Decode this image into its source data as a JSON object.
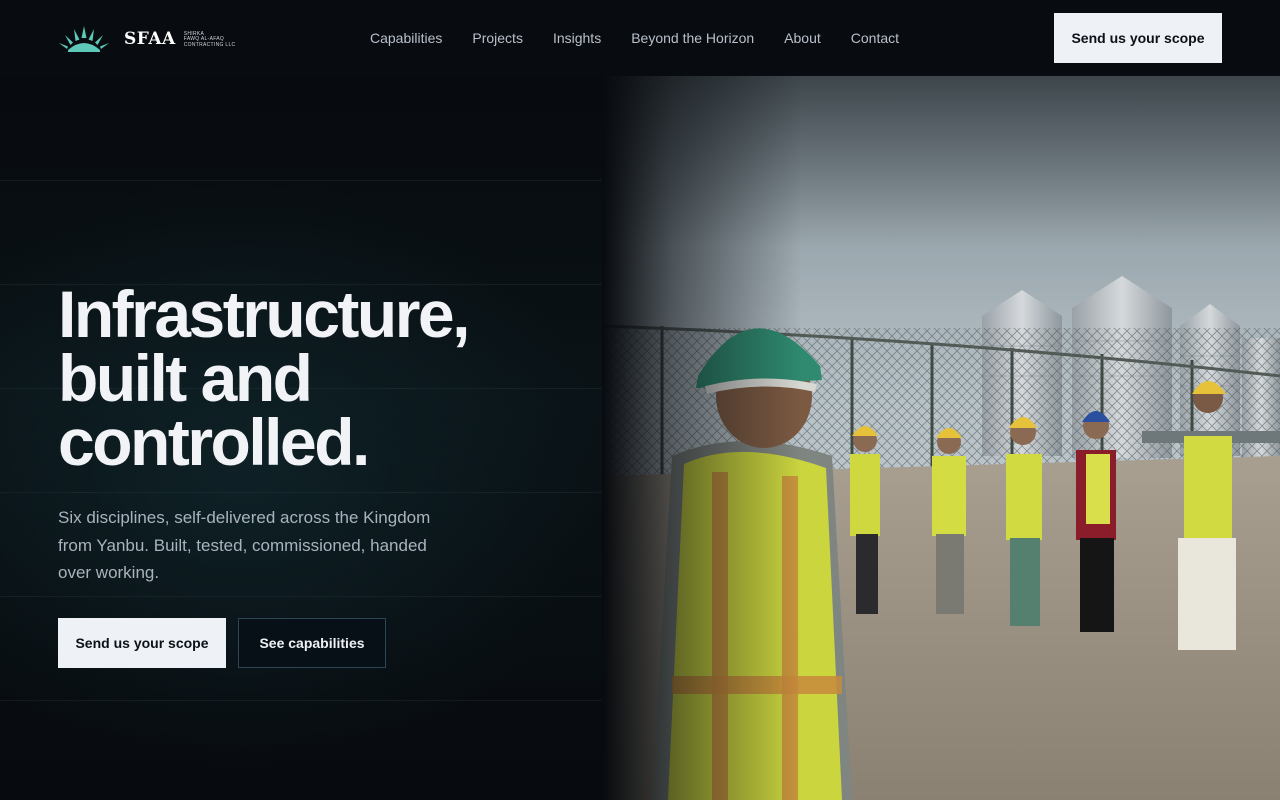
{
  "brand": {
    "name": "SFAA",
    "subtitle_lines": [
      "SHIRKA",
      "FAWQ AL-AFAQ",
      "CONTRACTING LLC"
    ],
    "logo_icon": "sunrise-icon",
    "accent_color": "#5ec9b8"
  },
  "nav": {
    "items": [
      {
        "label": "Capabilities"
      },
      {
        "label": "Projects"
      },
      {
        "label": "Insights"
      },
      {
        "label": "Beyond the Horizon"
      },
      {
        "label": "About"
      },
      {
        "label": "Contact"
      }
    ]
  },
  "header": {
    "cta_label": "Send us your scope"
  },
  "hero": {
    "title_lines": [
      "Infrastructure,",
      "built and",
      "controlled."
    ],
    "subtitle": "Six disciplines, self-delivered across the Kingdom from Yanbu. Built, tested, commissioned, handed over working.",
    "primary_cta": "Send us your scope",
    "secondary_cta": "See capabilities"
  },
  "colors": {
    "background": "#07090d",
    "button_light": "#eef1f5",
    "button_outline": "#2c4656",
    "text_muted": "#a9b3bd"
  }
}
